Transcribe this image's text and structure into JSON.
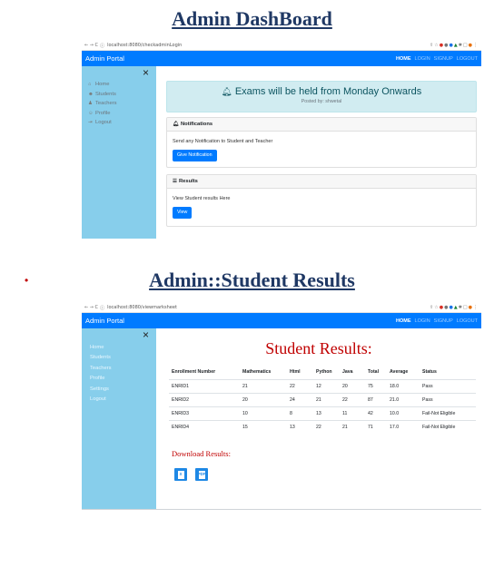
{
  "headings": {
    "dashboard": "Admin DashBoard",
    "results": "Admin::Student Results"
  },
  "bullet": "•",
  "browser": {
    "nav_icons": "← → C",
    "info_icon": "ⓘ",
    "dashboard_url": "localhost:8080/checkadminLogin",
    "results_url": "localhost:8080/viewmarksheet"
  },
  "app_nav": {
    "brand": "Admin Portal",
    "links": [
      "HOME",
      "LOGIN",
      "SIGNUP",
      "LOGOUT"
    ]
  },
  "dashboard": {
    "close_symbol": "×",
    "sidebar": [
      {
        "icon": "⌂",
        "label": "Home"
      },
      {
        "icon": "☻",
        "label": "Students"
      },
      {
        "icon": "♟",
        "label": "Teachers"
      },
      {
        "icon": "☺",
        "label": "Profile"
      },
      {
        "icon": "⇥",
        "label": "Logout"
      }
    ],
    "alert": {
      "title": "Exams will be held from Monday Onwards",
      "subtitle": "Posted by: shwetal"
    },
    "notifications": {
      "header": "Notifications",
      "text": "Send any Notification to Student and Teacher",
      "button": "Give Notification"
    },
    "results_card": {
      "header": "Results",
      "text": "View Student results Here",
      "button": "View"
    }
  },
  "results_page": {
    "close_symbol": "×",
    "sidebar": [
      "Home",
      "Students",
      "Teachers",
      "Profile",
      "Settings",
      "Logout"
    ],
    "title": "Student Results:",
    "table": {
      "columns": [
        "Enrollment Number",
        "Mathematics",
        "Html",
        "Python",
        "Java",
        "Total",
        "Average",
        "Status"
      ],
      "rows": [
        [
          "ENRID1",
          "21",
          "22",
          "12",
          "20",
          "75",
          "18.0",
          "Pass"
        ],
        [
          "ENRID2",
          "20",
          "24",
          "21",
          "22",
          "87",
          "21.0",
          "Pass"
        ],
        [
          "ENRID3",
          "10",
          "8",
          "13",
          "11",
          "42",
          "10.0",
          "Fail-Not Eligible"
        ],
        [
          "ENRID4",
          "15",
          "13",
          "22",
          "21",
          "71",
          "17.0",
          "Fail-Not Eligible"
        ]
      ]
    },
    "download_label": "Download Results:",
    "download_icons": [
      {
        "name": "excel-file-icon",
        "glyph": "X"
      },
      {
        "name": "pdf-file-icon",
        "glyph": "PDF"
      }
    ]
  },
  "colors": {
    "heading": "#1f3864",
    "accent_red": "#c00000",
    "navbar": "#007bff",
    "sidebar": "#87ceeb",
    "alert_bg": "#d1ecf1",
    "button": "#007bff"
  }
}
